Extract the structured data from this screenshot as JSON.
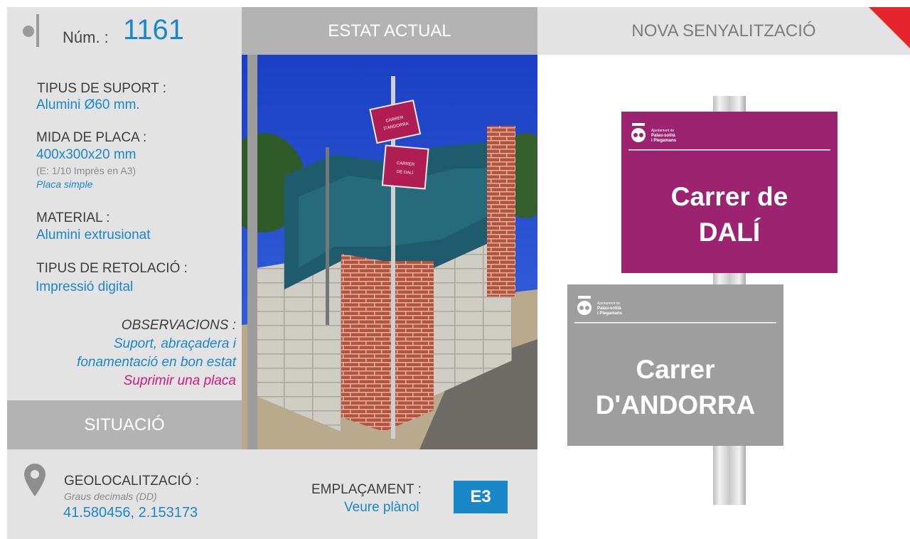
{
  "header": {
    "num_label": "Núm. :",
    "num_value": "1161",
    "estat_actual": "ESTAT ACTUAL",
    "nova_senyalitzacio": "NOVA SENYALITZACIÓ"
  },
  "info": {
    "tipus_suport_label": "TIPUS DE SUPORT :",
    "tipus_suport_value": "Alumini Ø60 mm.",
    "mida_placa_label": "MIDA DE PLACA :",
    "mida_placa_value": "400x300x20 mm",
    "mida_placa_scale": "(E: 1/10 Imprès en A3)",
    "mida_placa_type": "Placa simple",
    "material_label": "MATERIAL :",
    "material_value": "Alumini extrusionat",
    "retolacio_label": "TIPUS DE RETOLACIÓ :",
    "retolacio_value": "Impressió digital",
    "observacions_label": "OBSERVACIONS :",
    "observacions_line1": "Suport, abraçadera i",
    "observacions_line2": "fonamentació en bon estat",
    "observacions_line3": "Suprimir una placa"
  },
  "situacio": {
    "label": "SITUACIÓ"
  },
  "geo": {
    "label": "GEOLOCALITZACIÓ :",
    "format": "Graus decimals (DD)",
    "coords": "41.580456, 2.153173"
  },
  "emplacament": {
    "label": "EMPLAÇAMENT :",
    "link": "Veure plànol",
    "code": "E3"
  },
  "photo": {
    "sign1_line1": "CARRER",
    "sign1_line2": "D'ANDORRA",
    "sign2_line1": "CARRER",
    "sign2_line2": "DE DALÍ"
  },
  "signs": {
    "logo_line1": "Ajuntament de",
    "logo_line2": "Palau-solità",
    "logo_line3": "i Plegamans",
    "top": {
      "line1": "Carrer de",
      "line2": "DALÍ",
      "color": "#9b2370"
    },
    "bottom": {
      "line1": "Carrer",
      "line2": "D'ANDORRA",
      "color": "#9e9e9e"
    }
  },
  "colors": {
    "accent": "#1a87c9",
    "highlight": "#d11a7a",
    "corner": "#e5252e"
  }
}
